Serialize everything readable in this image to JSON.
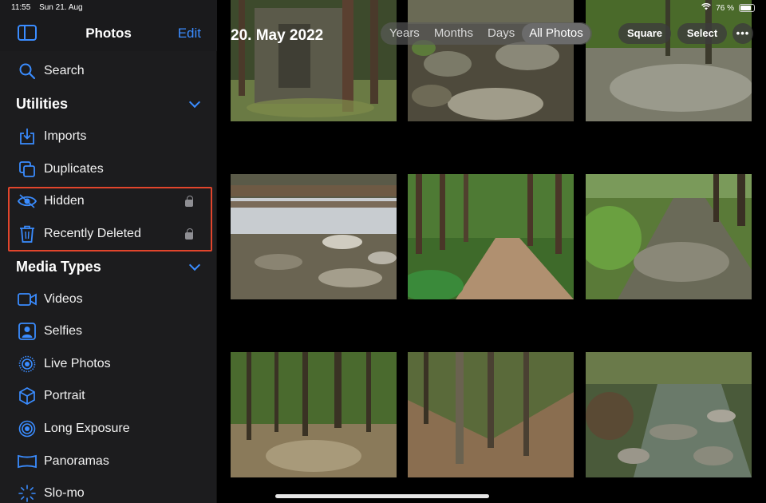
{
  "status": {
    "time": "11:55",
    "date": "Sun 21. Aug",
    "battery": "76 %"
  },
  "sidebar": {
    "title": "Photos",
    "edit_label": "Edit",
    "search_label": "Search",
    "utilities_header": "Utilities",
    "utilities": [
      {
        "label": "Imports"
      },
      {
        "label": "Duplicates"
      },
      {
        "label": "Hidden"
      },
      {
        "label": "Recently Deleted"
      }
    ],
    "media_header": "Media Types",
    "media": [
      {
        "label": "Videos"
      },
      {
        "label": "Selfies"
      },
      {
        "label": "Live Photos"
      },
      {
        "label": "Portrait"
      },
      {
        "label": "Long Exposure"
      },
      {
        "label": "Panoramas"
      },
      {
        "label": "Slo-mo"
      }
    ]
  },
  "main": {
    "date_title": "20. May 2022",
    "segments": [
      {
        "label": "Years"
      },
      {
        "label": "Months"
      },
      {
        "label": "Days"
      },
      {
        "label": "All Photos"
      }
    ],
    "active_segment": "All Photos",
    "square_label": "Square",
    "select_label": "Select",
    "more_label": "•••"
  },
  "colors": {
    "accent": "#3a8cff",
    "highlight": "#e2452c",
    "sidebar_bg": "#1c1c1e"
  }
}
